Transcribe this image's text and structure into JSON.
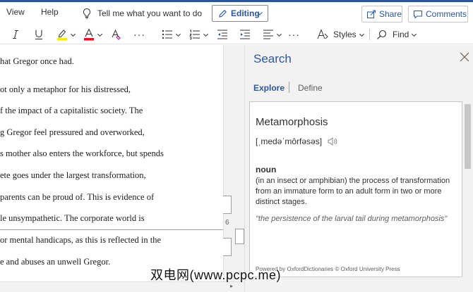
{
  "menu": {
    "view": "View",
    "help": "Help",
    "tell_me": "Tell me what you want to do",
    "editing": "Editing",
    "share": "Share",
    "comments": "Comments"
  },
  "toolbar": {
    "styles": "Styles",
    "find": "Find",
    "more": "···"
  },
  "document": {
    "lines": [
      "hat Gregor once had.",
      "ot only a metaphor for his distressed,",
      "f the impact of a capitalistic society. The",
      "g Gregor feel pressured and overworked,",
      "s mother also enters the workforce, but spends",
      "ete goes under the largest transformation,",
      "parents can be proud of. This is evidence of",
      "le unsympathetic. The corporate world is",
      "or mental handicaps, as this is reflected in the",
      "e and abuses an unwell Gregor."
    ],
    "page_number": "6"
  },
  "search_pane": {
    "title": "Search",
    "tabs": [
      "Explore",
      "Define"
    ],
    "active_tab": "Explore",
    "entry": {
      "word": "Metamorphosis",
      "pronunciation": "[ˌmedəˈmôrfəsəs]",
      "part_of_speech": "noun",
      "definition": "(in an insect or amphibian) the process of transformation from an immature form to an adult form in two or more distinct stages.",
      "example": "\"the persistence of the larval tail during metamorphosis\"",
      "attribution": "Powered by OxfordDictionaries © Oxford University Press"
    }
  },
  "watermark": "双电网(www.pcpc.me)",
  "colors": {
    "accent": "#2b579a",
    "highlight_yellow": "#ffe600",
    "font_red": "#e81123"
  }
}
